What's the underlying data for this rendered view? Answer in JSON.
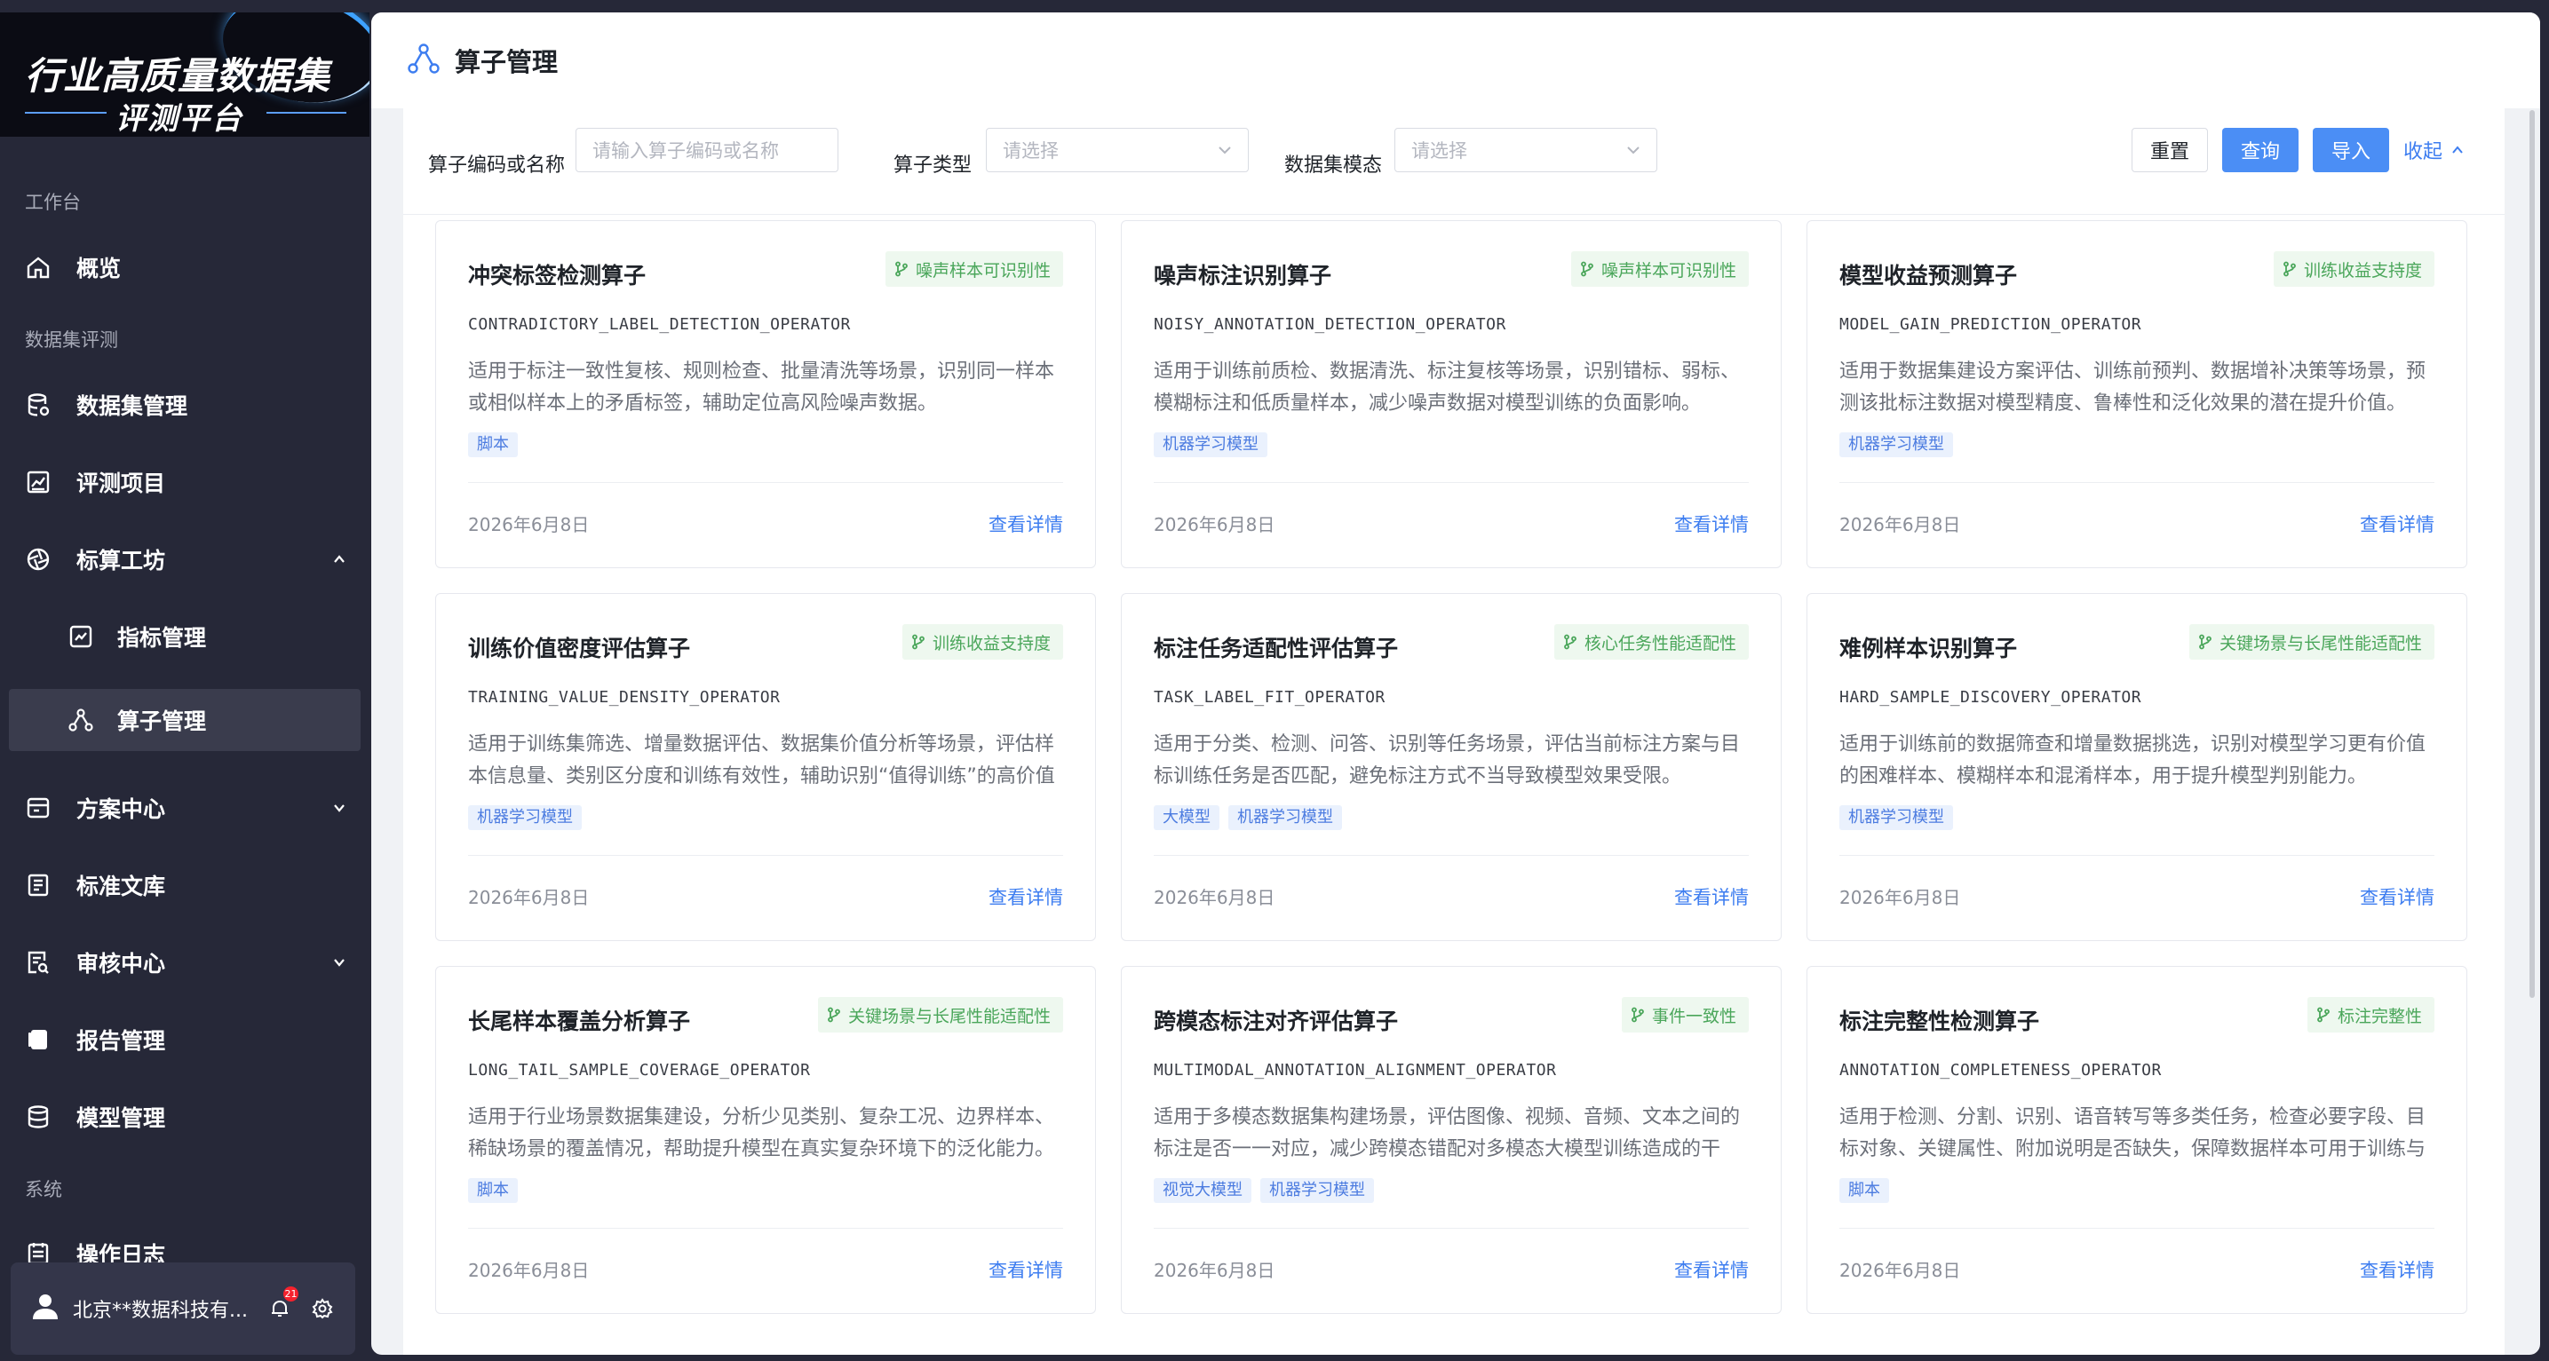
{
  "logo": {
    "line1": "行业高质量数据集",
    "line2": "评测平台"
  },
  "sidebar": {
    "sections": {
      "workbench": "工作台",
      "dataset_eval": "数据集评测",
      "system": "系统"
    },
    "items": [
      {
        "label": "概览"
      },
      {
        "label": "数据集管理"
      },
      {
        "label": "评测项目"
      },
      {
        "label": "标算工坊"
      },
      {
        "label": "指标管理"
      },
      {
        "label": "算子管理"
      },
      {
        "label": "方案中心"
      },
      {
        "label": "标准文库"
      },
      {
        "label": "审核中心"
      },
      {
        "label": "报告管理"
      },
      {
        "label": "模型管理"
      },
      {
        "label": "操作日志"
      }
    ],
    "user": {
      "name": "北京**数据科技有...",
      "notification_count": "21"
    }
  },
  "page": {
    "title": "算子管理"
  },
  "filters": {
    "code_label": "算子编码或名称",
    "code_placeholder": "请输入算子编码或名称",
    "type_label": "算子类型",
    "type_placeholder": "请选择",
    "modality_label": "数据集模态",
    "modality_placeholder": "请选择",
    "reset": "重置",
    "query": "查询",
    "import": "导入",
    "collapse": "收起"
  },
  "cards": [
    {
      "title": "冲突标签检测算子",
      "tag": "噪声样本可识别性",
      "code": "CONTRADICTORY_LABEL_DETECTION_OPERATOR",
      "desc": "适用于标注一致性复核、规则检查、批量清洗等场景，识别同一样本或相似样本上的矛盾标签，辅助定位高风险噪声数据。",
      "chips": [
        "脚本"
      ],
      "date": "2026年6月8日",
      "link": "查看详情"
    },
    {
      "title": "噪声标注识别算子",
      "tag": "噪声样本可识别性",
      "code": "NOISY_ANNOTATION_DETECTION_OPERATOR",
      "desc": "适用于训练前质检、数据清洗、标注复核等场景，识别错标、弱标、模糊标注和低质量样本，减少噪声数据对模型训练的负面影响。",
      "chips": [
        "机器学习模型"
      ],
      "date": "2026年6月8日",
      "link": "查看详情"
    },
    {
      "title": "模型收益预测算子",
      "tag": "训练收益支持度",
      "code": "MODEL_GAIN_PREDICTION_OPERATOR",
      "desc": "适用于数据集建设方案评估、训练前预判、数据增补决策等场景，预测该批标注数据对模型精度、鲁棒性和泛化效果的潜在提升价值。",
      "chips": [
        "机器学习模型"
      ],
      "date": "2026年6月8日",
      "link": "查看详情"
    },
    {
      "title": "训练价值密度评估算子",
      "tag": "训练收益支持度",
      "code": "TRAINING_VALUE_DENSITY_OPERATOR",
      "desc": "适用于训练集筛选、增量数据评估、数据集价值分析等场景，评估样本信息量、类别区分度和训练有效性，辅助识别“值得训练”的高价值数据。",
      "chips": [
        "机器学习模型"
      ],
      "date": "2026年6月8日",
      "link": "查看详情"
    },
    {
      "title": "标注任务适配性评估算子",
      "tag": "核心任务性能适配性",
      "code": "TASK_LABEL_FIT_OPERATOR",
      "desc": "适用于分类、检测、问答、识别等任务场景，评估当前标注方案与目标训练任务是否匹配，避免标注方式不当导致模型效果受限。",
      "chips": [
        "大模型",
        "机器学习模型"
      ],
      "date": "2026年6月8日",
      "link": "查看详情"
    },
    {
      "title": "难例样本识别算子",
      "tag": "关键场景与长尾性能适配性",
      "code": "HARD_SAMPLE_DISCOVERY_OPERATOR",
      "desc": "适用于训练前的数据筛查和增量数据挑选，识别对模型学习更有价值的困难样本、模糊样本和混淆样本，用于提升模型判别能力。",
      "chips": [
        "机器学习模型"
      ],
      "date": "2026年6月8日",
      "link": "查看详情"
    },
    {
      "title": "长尾样本覆盖分析算子",
      "tag": "关键场景与长尾性能适配性",
      "code": "LONG_TAIL_SAMPLE_COVERAGE_OPERATOR",
      "desc": "适用于行业场景数据集建设，分析少见类别、复杂工况、边界样本、稀缺场景的覆盖情况，帮助提升模型在真实复杂环境下的泛化能力。",
      "chips": [
        "脚本"
      ],
      "date": "2026年6月8日",
      "link": "查看详情"
    },
    {
      "title": "跨模态标注对齐评估算子",
      "tag": "事件一致性",
      "code": "MULTIMODAL_ANNOTATION_ALIGNMENT_OPERATOR",
      "desc": "适用于多模态数据集构建场景，评估图像、视频、音频、文本之间的标注是否一一对应，减少跨模态错配对多模态大模型训练造成的干扰。",
      "chips": [
        "视觉大模型",
        "机器学习模型"
      ],
      "date": "2026年6月8日",
      "link": "查看详情"
    },
    {
      "title": "标注完整性检测算子",
      "tag": "标注完整性",
      "code": "ANNOTATION_COMPLETENESS_OPERATOR",
      "desc": "适用于检测、分割、识别、语音转写等多类任务，检查必要字段、目标对象、关键属性、附加说明是否缺失，保障数据样本可用于训练与评...",
      "chips": [
        "脚本"
      ],
      "date": "2026年6月8日",
      "link": "查看详情"
    }
  ],
  "colors": {
    "accent": "#4b8ef5",
    "link": "#3d7df0",
    "tag_green": "#4aa65a",
    "sidebar_bg": "#262838"
  }
}
